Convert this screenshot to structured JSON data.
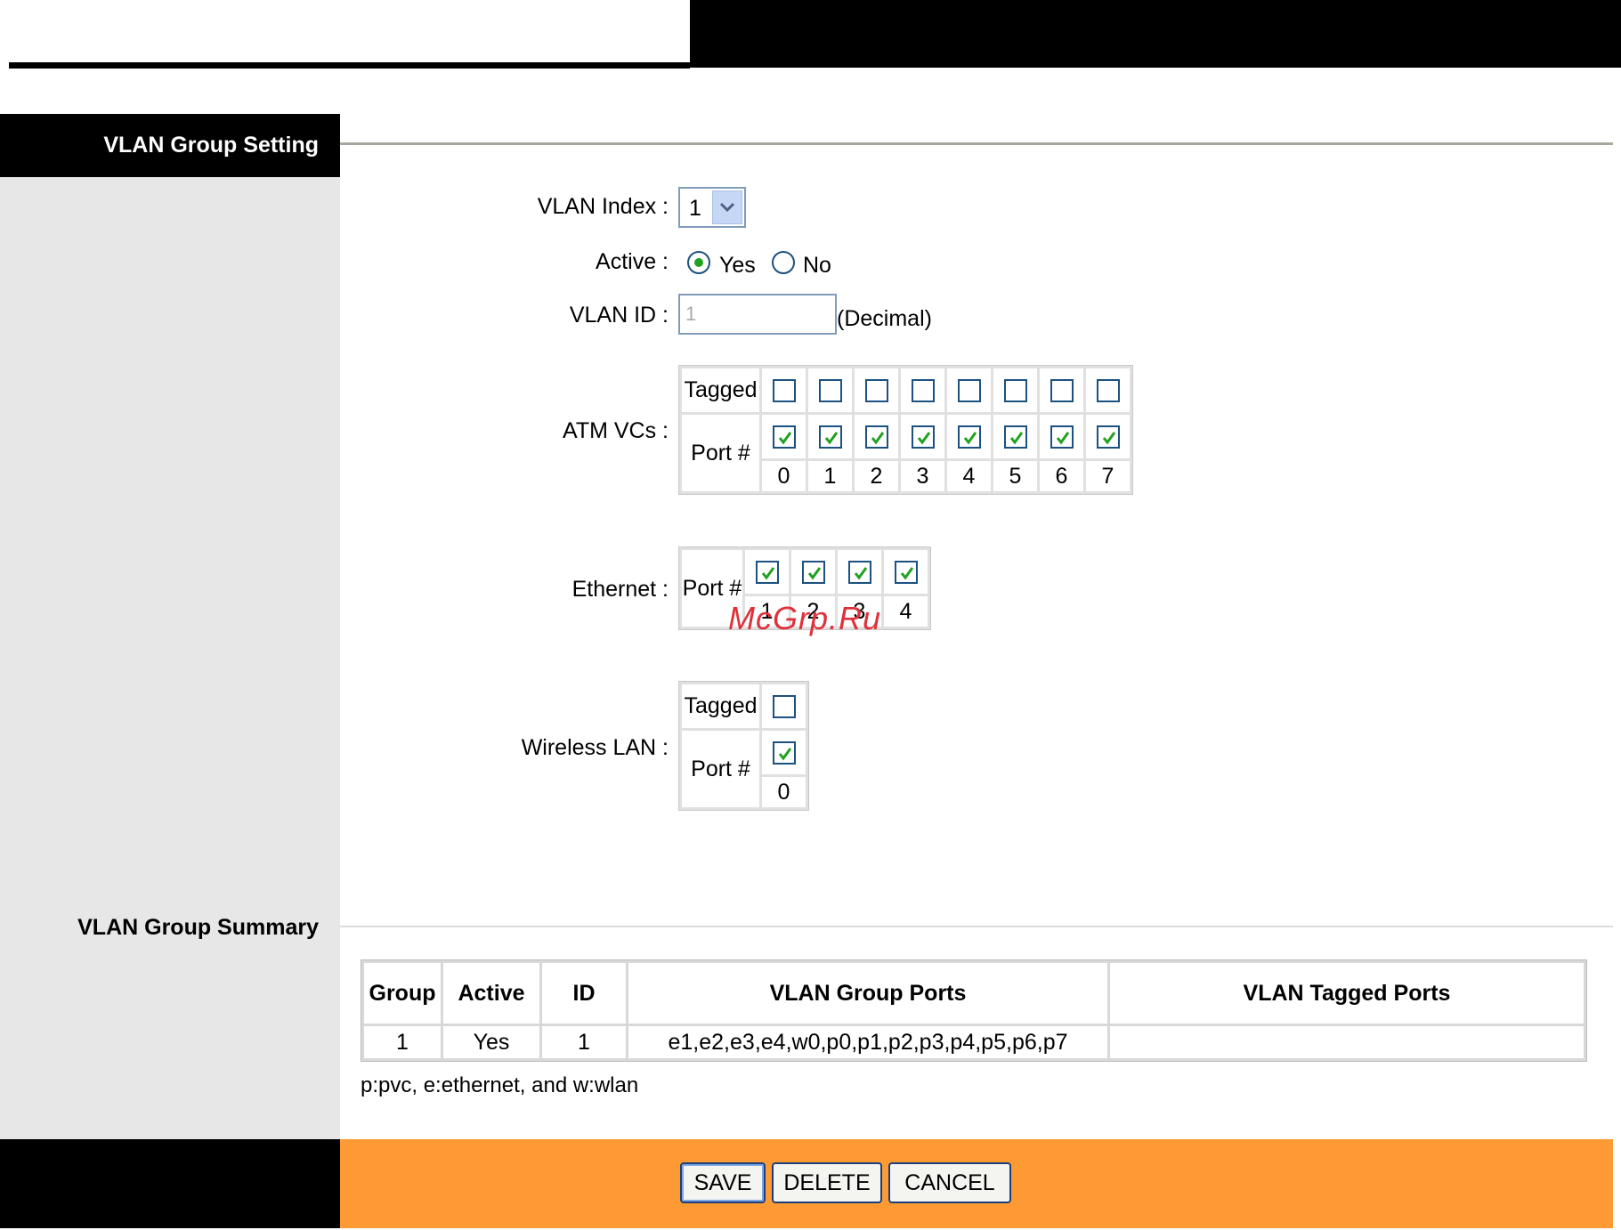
{
  "setting": {
    "title": "VLAN Group Setting",
    "vlan_index_label": "VLAN Index :",
    "vlan_index_value": "1",
    "active_label": "Active :",
    "active_yes": "Yes",
    "active_no": "No",
    "active_selected": "Yes",
    "vlan_id_label": "VLAN ID :",
    "vlan_id_value": "1",
    "vlan_id_unit": "(Decimal)",
    "atm": {
      "label": "ATM VCs :",
      "tagged_label": "Tagged",
      "port_label": "Port #",
      "ports": [
        "0",
        "1",
        "2",
        "3",
        "4",
        "5",
        "6",
        "7"
      ],
      "tagged": [
        false,
        false,
        false,
        false,
        false,
        false,
        false,
        false
      ],
      "member": [
        true,
        true,
        true,
        true,
        true,
        true,
        true,
        true
      ]
    },
    "ethernet": {
      "label": "Ethernet :",
      "port_label": "Port #",
      "ports": [
        "1",
        "2",
        "3",
        "4"
      ],
      "member": [
        true,
        true,
        true,
        true
      ]
    },
    "wireless": {
      "label": "Wireless LAN :",
      "tagged_label": "Tagged",
      "port_label": "Port #",
      "ports": [
        "0"
      ],
      "tagged": [
        false
      ],
      "member": [
        true
      ]
    }
  },
  "summary": {
    "title": "VLAN Group Summary",
    "headers": [
      "Group",
      "Active",
      "ID",
      "VLAN Group Ports",
      "VLAN Tagged Ports"
    ],
    "rows": [
      [
        "1",
        "Yes",
        "1",
        "e1,e2,e3,e4,w0,p0,p1,p2,p3,p4,p5,p6,p7",
        ""
      ]
    ],
    "legend": "p:pvc, e:ethernet, and w:wlan"
  },
  "buttons": {
    "save": "SAVE",
    "delete": "DELETE",
    "cancel": "CANCEL"
  },
  "watermark": "McGrp.Ru",
  "colors": {
    "footer_orange": "#fe9a33",
    "header_black": "#000000",
    "sidebar_gray": "#e7e7e7",
    "check_green": "#21a121"
  }
}
